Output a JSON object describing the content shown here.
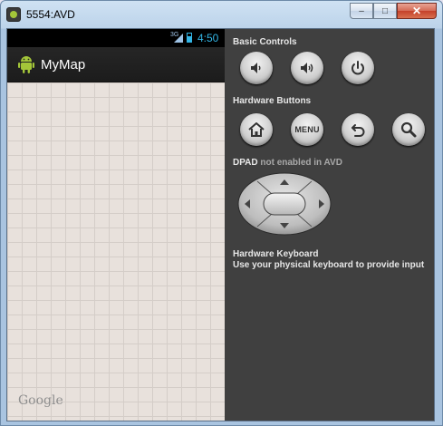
{
  "window": {
    "title": "5554:AVD",
    "buttons": {
      "minimize": "–",
      "maximize": "□",
      "close": "✕"
    }
  },
  "phone": {
    "status_bar": {
      "network": "3G",
      "time": "4:50"
    },
    "action_bar": {
      "app_name": "MyMap"
    },
    "map": {
      "logo": "Google"
    }
  },
  "controls": {
    "basic": {
      "label": "Basic Controls",
      "buttons": [
        "volume-down",
        "volume-up",
        "power"
      ]
    },
    "hardware": {
      "label": "Hardware Buttons",
      "menu_label": "MENU",
      "buttons": [
        "home",
        "menu",
        "back",
        "search"
      ]
    },
    "dpad": {
      "label": "DPAD",
      "status": "not enabled in AVD"
    },
    "keyboard": {
      "title": "Hardware Keyboard",
      "description": "Use your physical keyboard to provide input"
    }
  },
  "colors": {
    "status_accent": "#33b5e5",
    "map_background": "#e8e1dc",
    "panel_background": "#404040"
  }
}
